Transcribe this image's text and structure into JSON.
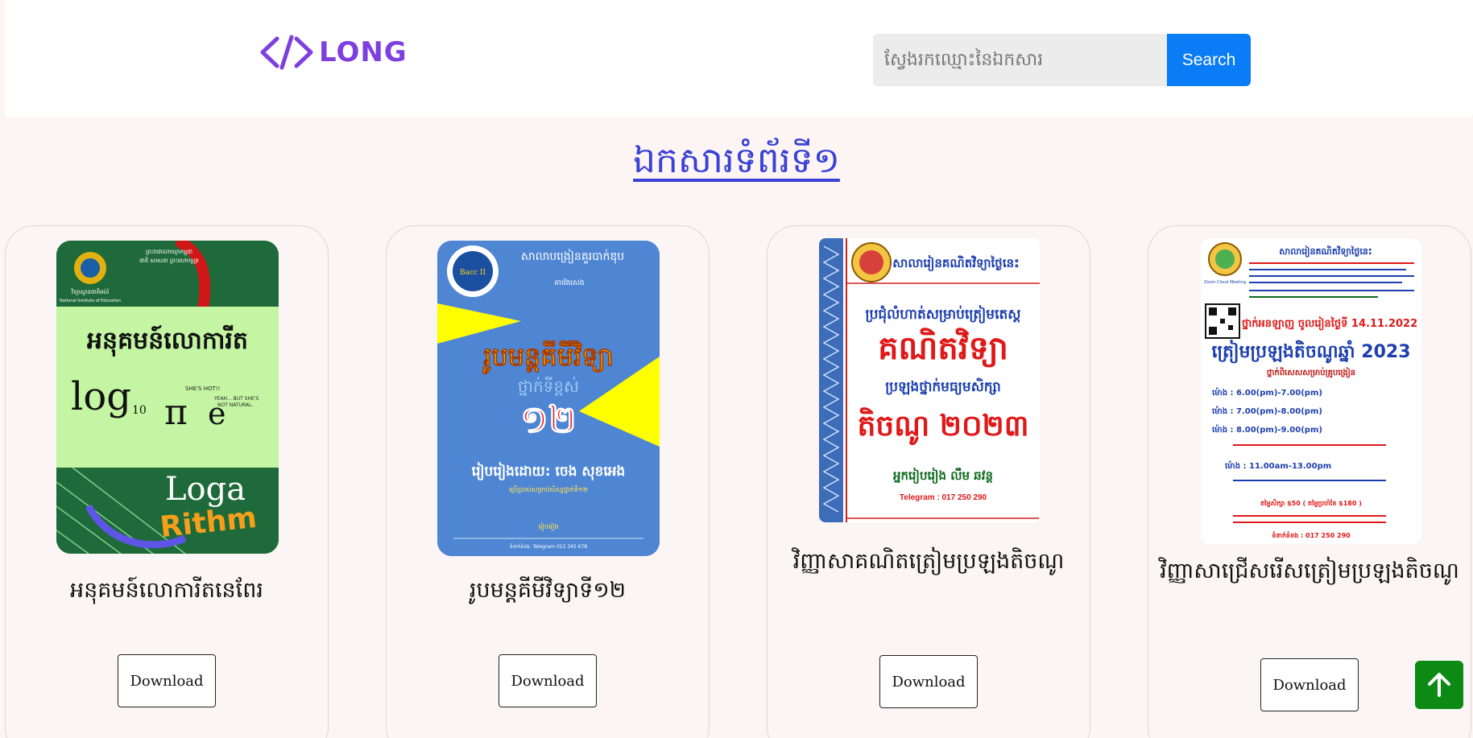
{
  "header": {
    "logo_text": "LONG",
    "search_placeholder": "ស្វែងរកឈ្មោះនៃឯកសារ",
    "search_button": "Search"
  },
  "page_heading": "ឯកសារទំព័រទី១",
  "colors": {
    "accent": "#0a7cf5",
    "brand": "#7e3fe0",
    "heading": "#3a41d6",
    "scroll_top": "#0d8a14"
  },
  "cards": [
    {
      "title": "អនុគមន៍លោការីតនេពែរ",
      "download_label": "Download",
      "cover": {
        "header_lines": [
          "ព្រះរាជាណាចក្រកម្ពុជា",
          "ជាតិ សាសនា ព្រះមហាក្សត្រ"
        ],
        "institute": "វិទ្យាស្ថានជាតិអប់រំ",
        "institute_en": "National Institute of Education",
        "main_title": "អនុគមន៍លោការីត",
        "math_log": "log",
        "math_sub": "10",
        "math_pi": "π",
        "math_e": "e",
        "speech_1": "SHE'S HOT!!",
        "speech_2": "YEAH... BUT SHE'S NOT NATURAL.",
        "word_1": "Loga",
        "word_2": "Rithm"
      }
    },
    {
      "title": "រូបមន្តគីមីវិទ្យាទី១២",
      "download_label": "Download",
      "cover": {
        "school": "សាលាបង្រៀនគួរបាក់ឌុប",
        "small_line": "គាវ៉េងសេង",
        "badge": "Bacc II",
        "main_title": "រូបមន្តគីមីវិទ្យា",
        "subtitle": "ថ្នាក់ទីខ្ពស់",
        "grade": "១២",
        "author": "រៀបរៀងដោយ: ចេង សុខអេង",
        "note": "ប្រើប្រាស់សម្រាប់សិស្សថ្នាក់ទី១២",
        "footer_mid": "រៀបរៀង",
        "footer": "ទំនាក់ទំនង: Telegram 012 345 678"
      }
    },
    {
      "title": "វិញ្ញាសាគណិតត្រៀមប្រឡងតិចណូ",
      "download_label": "Download",
      "cover": {
        "school": "សាលារៀនគណិតវិទ្យាថ្ងៃនេះ",
        "line_1": "ប្រជុំលំហាត់សម្រាប់ត្រៀមតេស្ត",
        "main_title": "គណិតវិទ្យា",
        "line_2": "ប្រឡងថ្នាក់មធ្យមសិក្សា",
        "year": "តិចណូ ២០២៣",
        "author": "អ្នករៀបរៀង លឹម ឆវន្ត",
        "telegram": "Telegram : 017 250 290"
      }
    },
    {
      "title": "វិញ្ញាសាជ្រើសរើសត្រៀមប្រឡងតិចណូ",
      "download_label": "Download",
      "cover": {
        "school": "សាលារៀនគណិតវិទ្យាថ្ងៃនេះ",
        "zoom": "Zoom Cloud Meeting",
        "date_line": "ថ្នាក់អនឡាញ ចូលរៀនថ្ងៃទី 14.11.2022",
        "main_title": "ត្រៀមប្រឡងតិចណូឆ្នាំ 2023",
        "sub": "ថ្នាក់ពិសេសសម្រាប់គ្រូបង្រៀន",
        "time_1": "ម៉ោង : 6.00(pm)-7.00(pm)",
        "time_2": "ម៉ោង : 7.00(pm)-8.00(pm)",
        "time_3": "ម៉ោង : 8.00(pm)-9.00(pm)",
        "time_4": "ម៉ោង : 11.00am-13.00pm",
        "fee": "តម្លៃសិក្សា $50 ( តម្លៃប្រចាំខែ $180 )",
        "telegram": "ទំនាក់ទំនង : 017 250 290"
      }
    }
  ]
}
